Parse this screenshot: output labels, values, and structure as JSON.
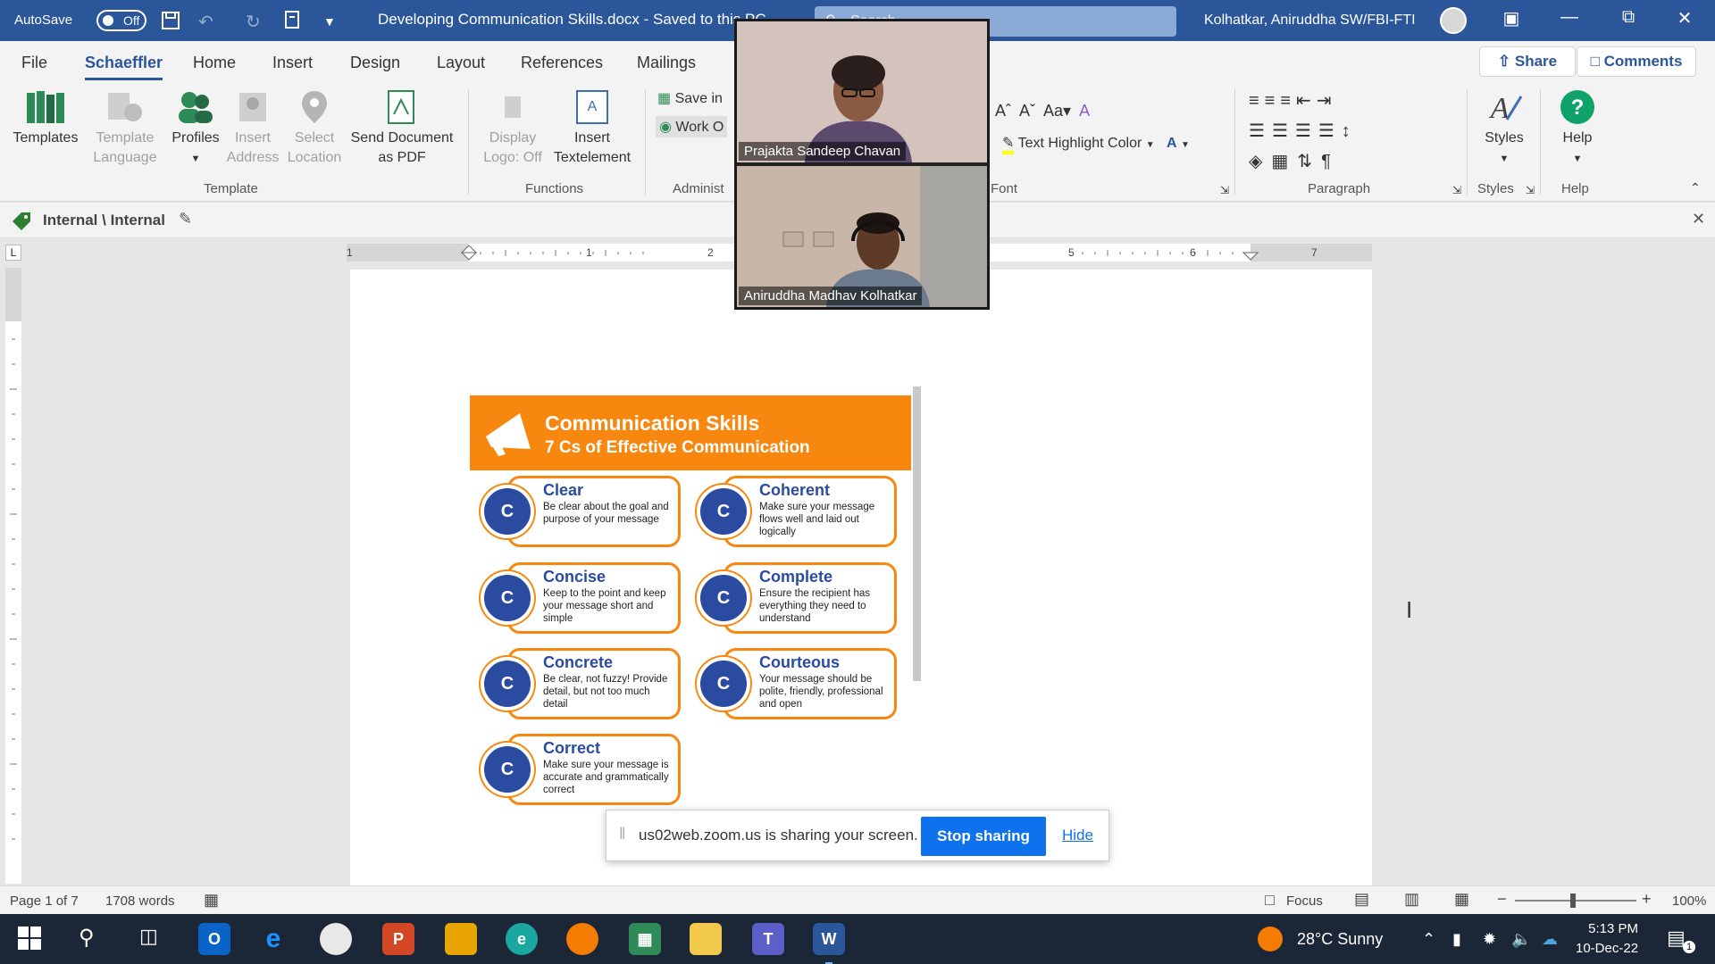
{
  "titlebar": {
    "autosave_label": "AutoSave",
    "autosave_state": "Off",
    "doc_title": "Developing Communication Skills.docx  -  Saved to this PC",
    "search_placeholder": "Search",
    "user_name": "Kolhatkar, Aniruddha SW/FBI-FTI"
  },
  "tabs": [
    "File",
    "Schaeffler",
    "Home",
    "Insert",
    "Design",
    "Layout",
    "References",
    "Mailings"
  ],
  "active_tab": "Schaeffler",
  "share_label": "Share",
  "comments_label": "Comments",
  "ribbon": {
    "templates": "Templates",
    "template_language": [
      "Template",
      "Language"
    ],
    "profiles": "Profiles",
    "insert_address": [
      "Insert",
      "Address"
    ],
    "select_location": [
      "Select",
      "Location"
    ],
    "send_pdf": [
      "Send Document",
      "as PDF"
    ],
    "group_template": "Template",
    "display_logo": [
      "Display",
      "Logo: Off"
    ],
    "insert_textelement": [
      "Insert",
      "Textelement"
    ],
    "group_functions": "Functions",
    "save_in": "Save in",
    "work_on": "Work O",
    "group_admin": "Administ",
    "group_font": "Font",
    "text_highlight": "Text Highlight Color",
    "group_paragraph": "Paragraph",
    "styles": "Styles",
    "group_styles": "Styles",
    "help": "Help",
    "group_help": "Help"
  },
  "label_bar": {
    "text": "Internal \\ Internal"
  },
  "ruler_numbers": [
    "1",
    "1",
    "2",
    "5",
    "6",
    "7"
  ],
  "infographic": {
    "title": "Communication Skills",
    "subtitle": "7 Cs of Effective Communication",
    "letter": "C",
    "items": [
      {
        "name": "Clear",
        "desc": "Be clear about the goal and purpose of your message"
      },
      {
        "name": "Coherent",
        "desc": "Make sure your message flows well and laid out logically"
      },
      {
        "name": "Concise",
        "desc": "Keep to the point and keep your message short and simple"
      },
      {
        "name": "Complete",
        "desc": "Ensure the recipient has everything they need to understand"
      },
      {
        "name": "Concrete",
        "desc": "Be clear, not fuzzy! Provide detail, but not too much detail"
      },
      {
        "name": "Courteous",
        "desc": "Your message should be polite, friendly, professional and open"
      },
      {
        "name": "Correct",
        "desc": "Make sure your message is accurate and grammatically correct"
      }
    ]
  },
  "video": {
    "participant1": "Prajakta Sandeep Chavan",
    "participant2": "Aniruddha Madhav Kolhatkar"
  },
  "sharebar": {
    "message": "us02web.zoom.us is sharing your screen.",
    "stop_label": "Stop sharing",
    "hide_label": "Hide"
  },
  "statusbar": {
    "page": "Page 1 of 7",
    "words": "1708 words",
    "focus": "Focus",
    "zoom": "100%"
  },
  "taskbar": {
    "weather": "28°C  Sunny",
    "time": "5:13 PM",
    "date": "10-Dec-22",
    "notification_count": "1"
  },
  "colors": {
    "word_blue": "#2b579a",
    "orange": "#f7870f",
    "navy": "#2a4ba0",
    "zoom_blue": "#0e72ed"
  }
}
